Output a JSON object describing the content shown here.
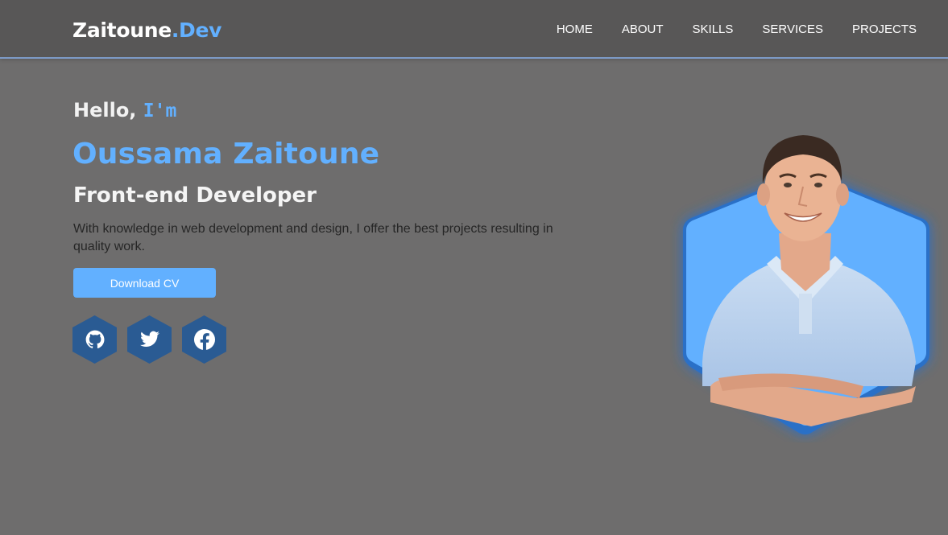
{
  "brand": {
    "name": "Zaitoune",
    "suffix": ".Dev"
  },
  "nav": {
    "items": [
      "HOME",
      "ABOUT",
      "SKILLS",
      "SERVICES",
      "PROJECTS"
    ]
  },
  "hero": {
    "greeting": "Hello,",
    "greeting_accent": "I'm",
    "name": "Oussama Zaitoune",
    "role": "Front-end Developer",
    "description": "With knowledge in web development and design, I offer the best projects resulting in quality work.",
    "cta_label": "Download CV"
  },
  "socials": [
    {
      "icon": "github-icon"
    },
    {
      "icon": "twitter-icon"
    },
    {
      "icon": "facebook-icon"
    }
  ],
  "colors": {
    "accent": "#62b0ff",
    "background": "#6e6d6d",
    "navbar": "#585757",
    "social_bg": "#2a5b93"
  }
}
